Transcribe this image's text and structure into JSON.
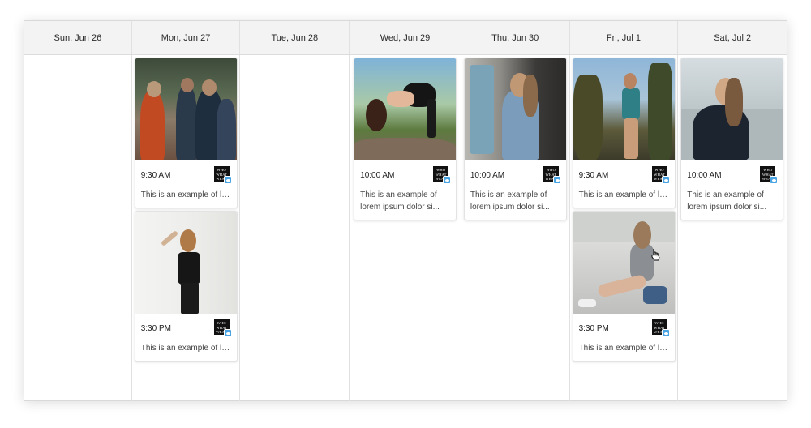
{
  "days": [
    {
      "label": "Sun, Jun 26"
    },
    {
      "label": "Mon, Jun 27"
    },
    {
      "label": "Tue, Jun 28"
    },
    {
      "label": "Wed, Jun 29"
    },
    {
      "label": "Thu, Jun 30"
    },
    {
      "label": "Fri, Jul 1"
    },
    {
      "label": "Sat, Jul 2"
    }
  ],
  "posts": {
    "mon_1": {
      "time": "9:30 AM",
      "text": "This is an example of lorem ipsum dolor sit amet",
      "network": "twitter-icon",
      "account": "WHO WHAT WEAR"
    },
    "mon_2": {
      "time": "3:30 PM",
      "text": "This is an example of lorem ipsum dolor sit amet",
      "network": "twitter-icon",
      "account": "WHO WHAT WEAR"
    },
    "wed_1": {
      "time": "10:00 AM",
      "text": "This is an example of lorem ipsum dolor si...",
      "network": "twitter-icon",
      "account": "WHO WHAT WEAR"
    },
    "thu_1": {
      "time": "10:00 AM",
      "text": "This is an example of lorem ipsum dolor si...",
      "network": "twitter-icon",
      "account": "WHO WHAT WEAR"
    },
    "fri_1": {
      "time": "9:30 AM",
      "text": "This is an example of lorem ipsum dolor sit amet",
      "network": "twitter-icon",
      "account": "WHO WHAT WEAR"
    },
    "fri_2": {
      "time": "3:30 PM",
      "text": "This is an example of lorem ipsum dolor sit amet",
      "network": "twitter-icon",
      "account": "WHO WHAT WEAR"
    },
    "sat_1": {
      "time": "10:00 AM",
      "text": "This is an example of lorem ipsum dolor si...",
      "network": "twitter-icon",
      "account": "WHO WHAT WEAR"
    }
  },
  "colors": {
    "twitter": "#4aa3e3",
    "header_bg": "#f3f3f3",
    "border": "#e1e1e1"
  }
}
